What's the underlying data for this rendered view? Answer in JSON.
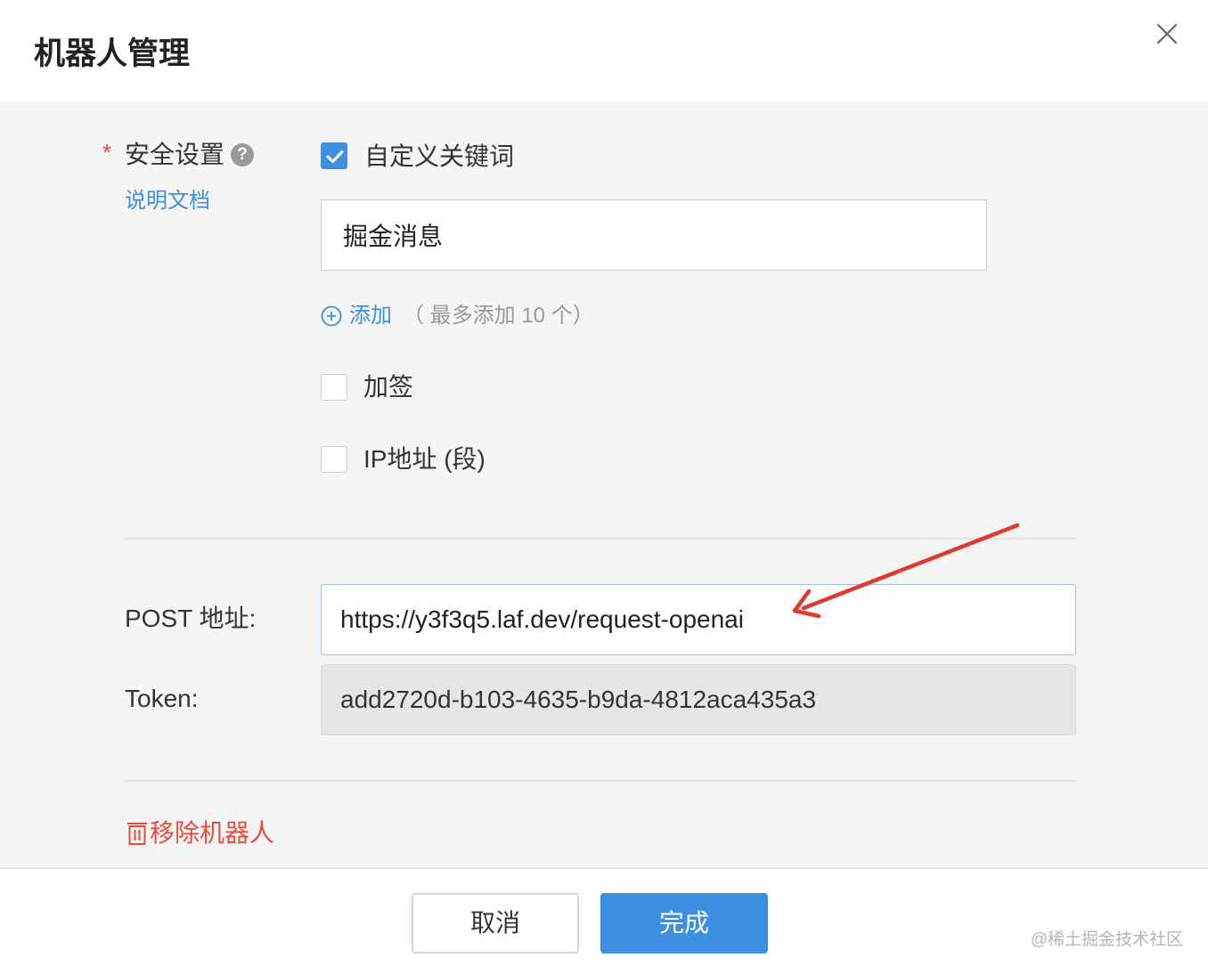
{
  "dialog": {
    "title": "机器人管理",
    "close_icon": "close-icon"
  },
  "security": {
    "required_mark": "*",
    "label": "安全设置",
    "help_icon": "question-circle-icon",
    "help_glyph": "?",
    "doc_link": "说明文档",
    "custom_keyword": {
      "checked": true,
      "label": "自定义关键词",
      "value": "掘金消息"
    },
    "add": {
      "icon": "plus-circle-icon",
      "label": "添加",
      "hint": "（ 最多添加 10 个）"
    },
    "sign": {
      "checked": false,
      "label": "加签"
    },
    "ip": {
      "checked": false,
      "label": "IP地址 (段)"
    }
  },
  "post": {
    "label": "POST 地址:",
    "value": "https://y3f3q5.laf.dev/request-openai"
  },
  "token": {
    "label": "Token:",
    "value": "add2720d-b103-4635-b9da-4812aca435a3"
  },
  "annotation": {
    "icon": "red-arrow-icon",
    "color": "#e03a2f"
  },
  "remove": {
    "icon": "trash-icon",
    "label": "移除机器人"
  },
  "footer": {
    "cancel_label": "取消",
    "done_label": "完成",
    "watermark": "@稀土掘金技术社区"
  },
  "colors": {
    "accent": "#3d8fe0",
    "danger": "#e74c3c",
    "body_bg": "#f5f5f5"
  }
}
